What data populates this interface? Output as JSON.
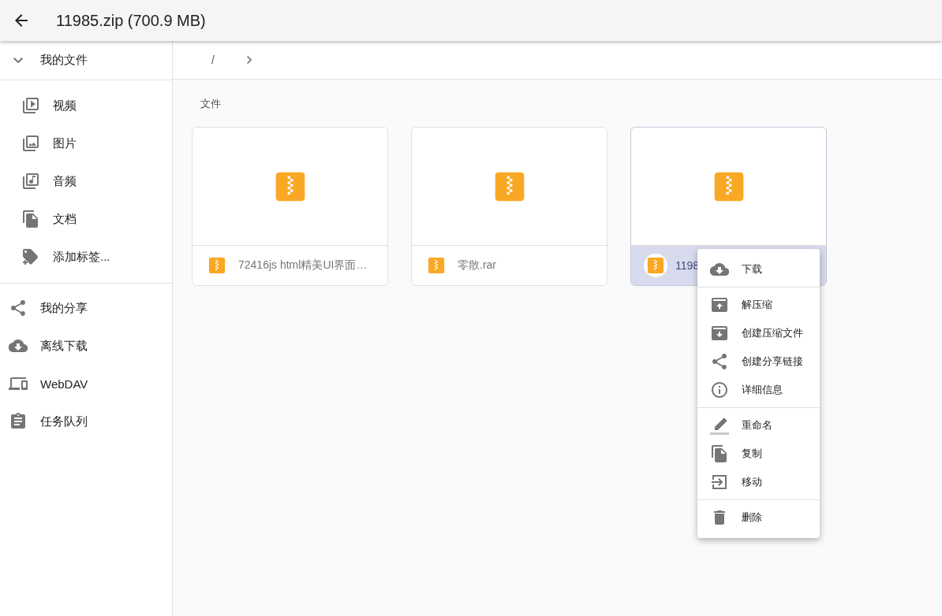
{
  "header": {
    "title": "11985.zip (700.9 MB)"
  },
  "sidebar": {
    "root": {
      "label": "我的文件",
      "expanded": true
    },
    "folders": [
      {
        "kind": "video",
        "label": "视频"
      },
      {
        "kind": "image",
        "label": "图片"
      },
      {
        "kind": "audio",
        "label": "音频"
      },
      {
        "kind": "doc",
        "label": "文档"
      },
      {
        "kind": "tag",
        "label": "添加标签..."
      }
    ],
    "items": [
      {
        "kind": "share",
        "label": "我的分享"
      },
      {
        "kind": "cloud",
        "label": "离线下载"
      },
      {
        "kind": "devices",
        "label": "WebDAV"
      },
      {
        "kind": "task",
        "label": "任务队列"
      }
    ]
  },
  "breadcrumb": {
    "path": "/"
  },
  "section_title": "文件",
  "files": [
    {
      "name": "72416js html精美UI界面…",
      "selected": false
    },
    {
      "name": "零散.rar",
      "selected": false
    },
    {
      "name": "1198",
      "selected": true
    }
  ],
  "context_menu": [
    [
      {
        "kind": "download",
        "label": "下载"
      }
    ],
    [
      {
        "kind": "extract",
        "label": "解压缩"
      },
      {
        "kind": "compress",
        "label": "创建压缩文件"
      },
      {
        "kind": "share",
        "label": "创建分享链接"
      },
      {
        "kind": "info",
        "label": "详细信息"
      }
    ],
    [
      {
        "kind": "rename",
        "label": "重命名"
      },
      {
        "kind": "copy",
        "label": "复制"
      },
      {
        "kind": "move",
        "label": "移动"
      }
    ],
    [
      {
        "kind": "delete",
        "label": "删除"
      }
    ]
  ]
}
